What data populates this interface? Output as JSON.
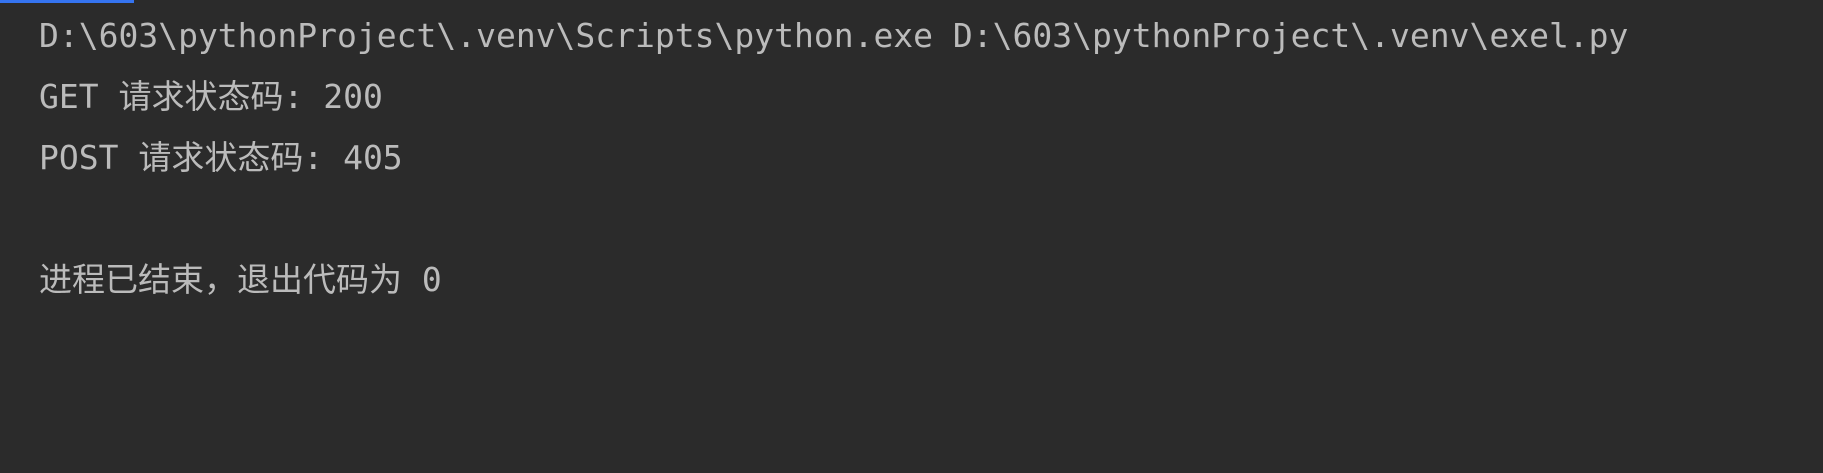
{
  "console": {
    "lines": [
      "D:\\603\\pythonProject\\.venv\\Scripts\\python.exe D:\\603\\pythonProject\\.venv\\exel.py",
      "GET 请求状态码: 200",
      "POST 请求状态码: 405",
      "",
      "进程已结束，退出代码为 0"
    ]
  },
  "colors": {
    "background": "#2b2b2b",
    "text": "#bbbbbb",
    "accent": "#3574f0"
  }
}
